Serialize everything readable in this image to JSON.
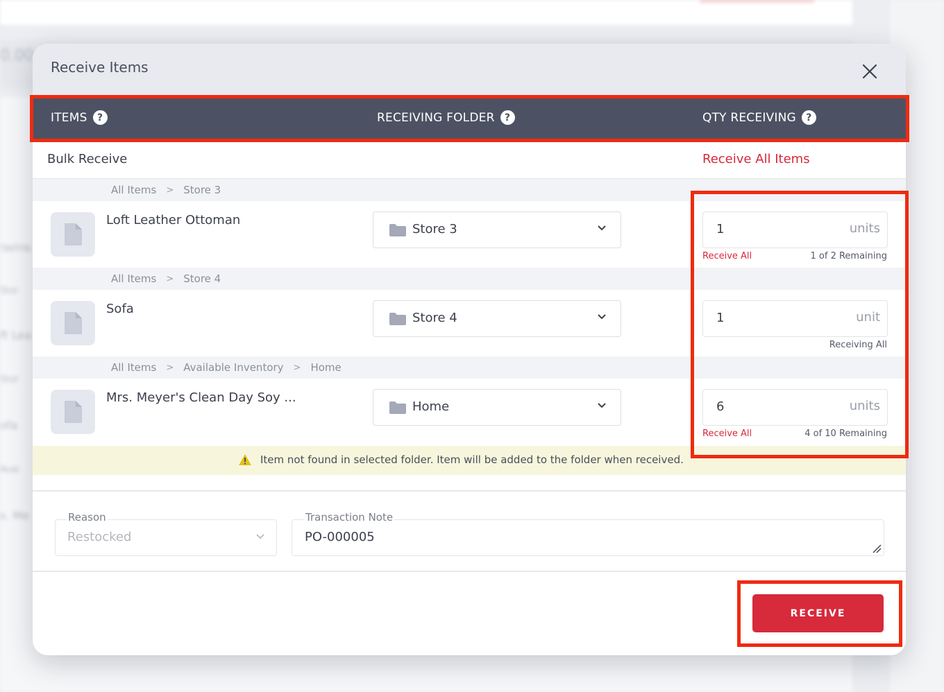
{
  "background": {
    "fragments": [
      "0.00 (",
      "TAFFIN",
      "Stor",
      "ft Lea",
      "Stor",
      "ofa",
      "Avai",
      "s. Me"
    ]
  },
  "modal": {
    "title": "Receive Items",
    "close_icon": "close-icon"
  },
  "columns": {
    "items": "ITEMS",
    "folder": "RECEIVING FOLDER",
    "qty": "QTY RECEIVING",
    "help_glyph": "?"
  },
  "bulk": {
    "label": "Bulk Receive",
    "action": "Receive All Items"
  },
  "items": [
    {
      "breadcrumb": [
        "All Items",
        "Store 3"
      ],
      "name": "Loft Leather Ottoman",
      "folder": "Store 3",
      "qty": "1",
      "unit": "units",
      "link": "Receive All",
      "status": "1 of 2 Remaining"
    },
    {
      "breadcrumb": [
        "All Items",
        "Store 4"
      ],
      "name": "Sofa",
      "folder": "Store 4",
      "qty": "1",
      "unit": "unit",
      "link": "",
      "status": "Receiving All"
    },
    {
      "breadcrumb": [
        "All Items",
        "Available Inventory",
        "Home"
      ],
      "name": "Mrs. Meyer's Clean Day Soy ...",
      "folder": "Home",
      "qty": "6",
      "unit": "units",
      "link": "Receive All",
      "status": "4 of 10 Remaining"
    }
  ],
  "breadcrumb_separator": ">",
  "warning": {
    "text": "Item not found in selected folder. Item will be added to the folder when received.",
    "color": "#e2c21a"
  },
  "form": {
    "reason_label": "Reason",
    "reason_value": "Restocked",
    "note_label": "Transaction Note",
    "note_value": "PO-000005"
  },
  "actions": {
    "receive": "RECEIVE"
  },
  "colors": {
    "accent": "#d72a3b",
    "header": "#4c5263",
    "annotation": "#ee2b10"
  }
}
